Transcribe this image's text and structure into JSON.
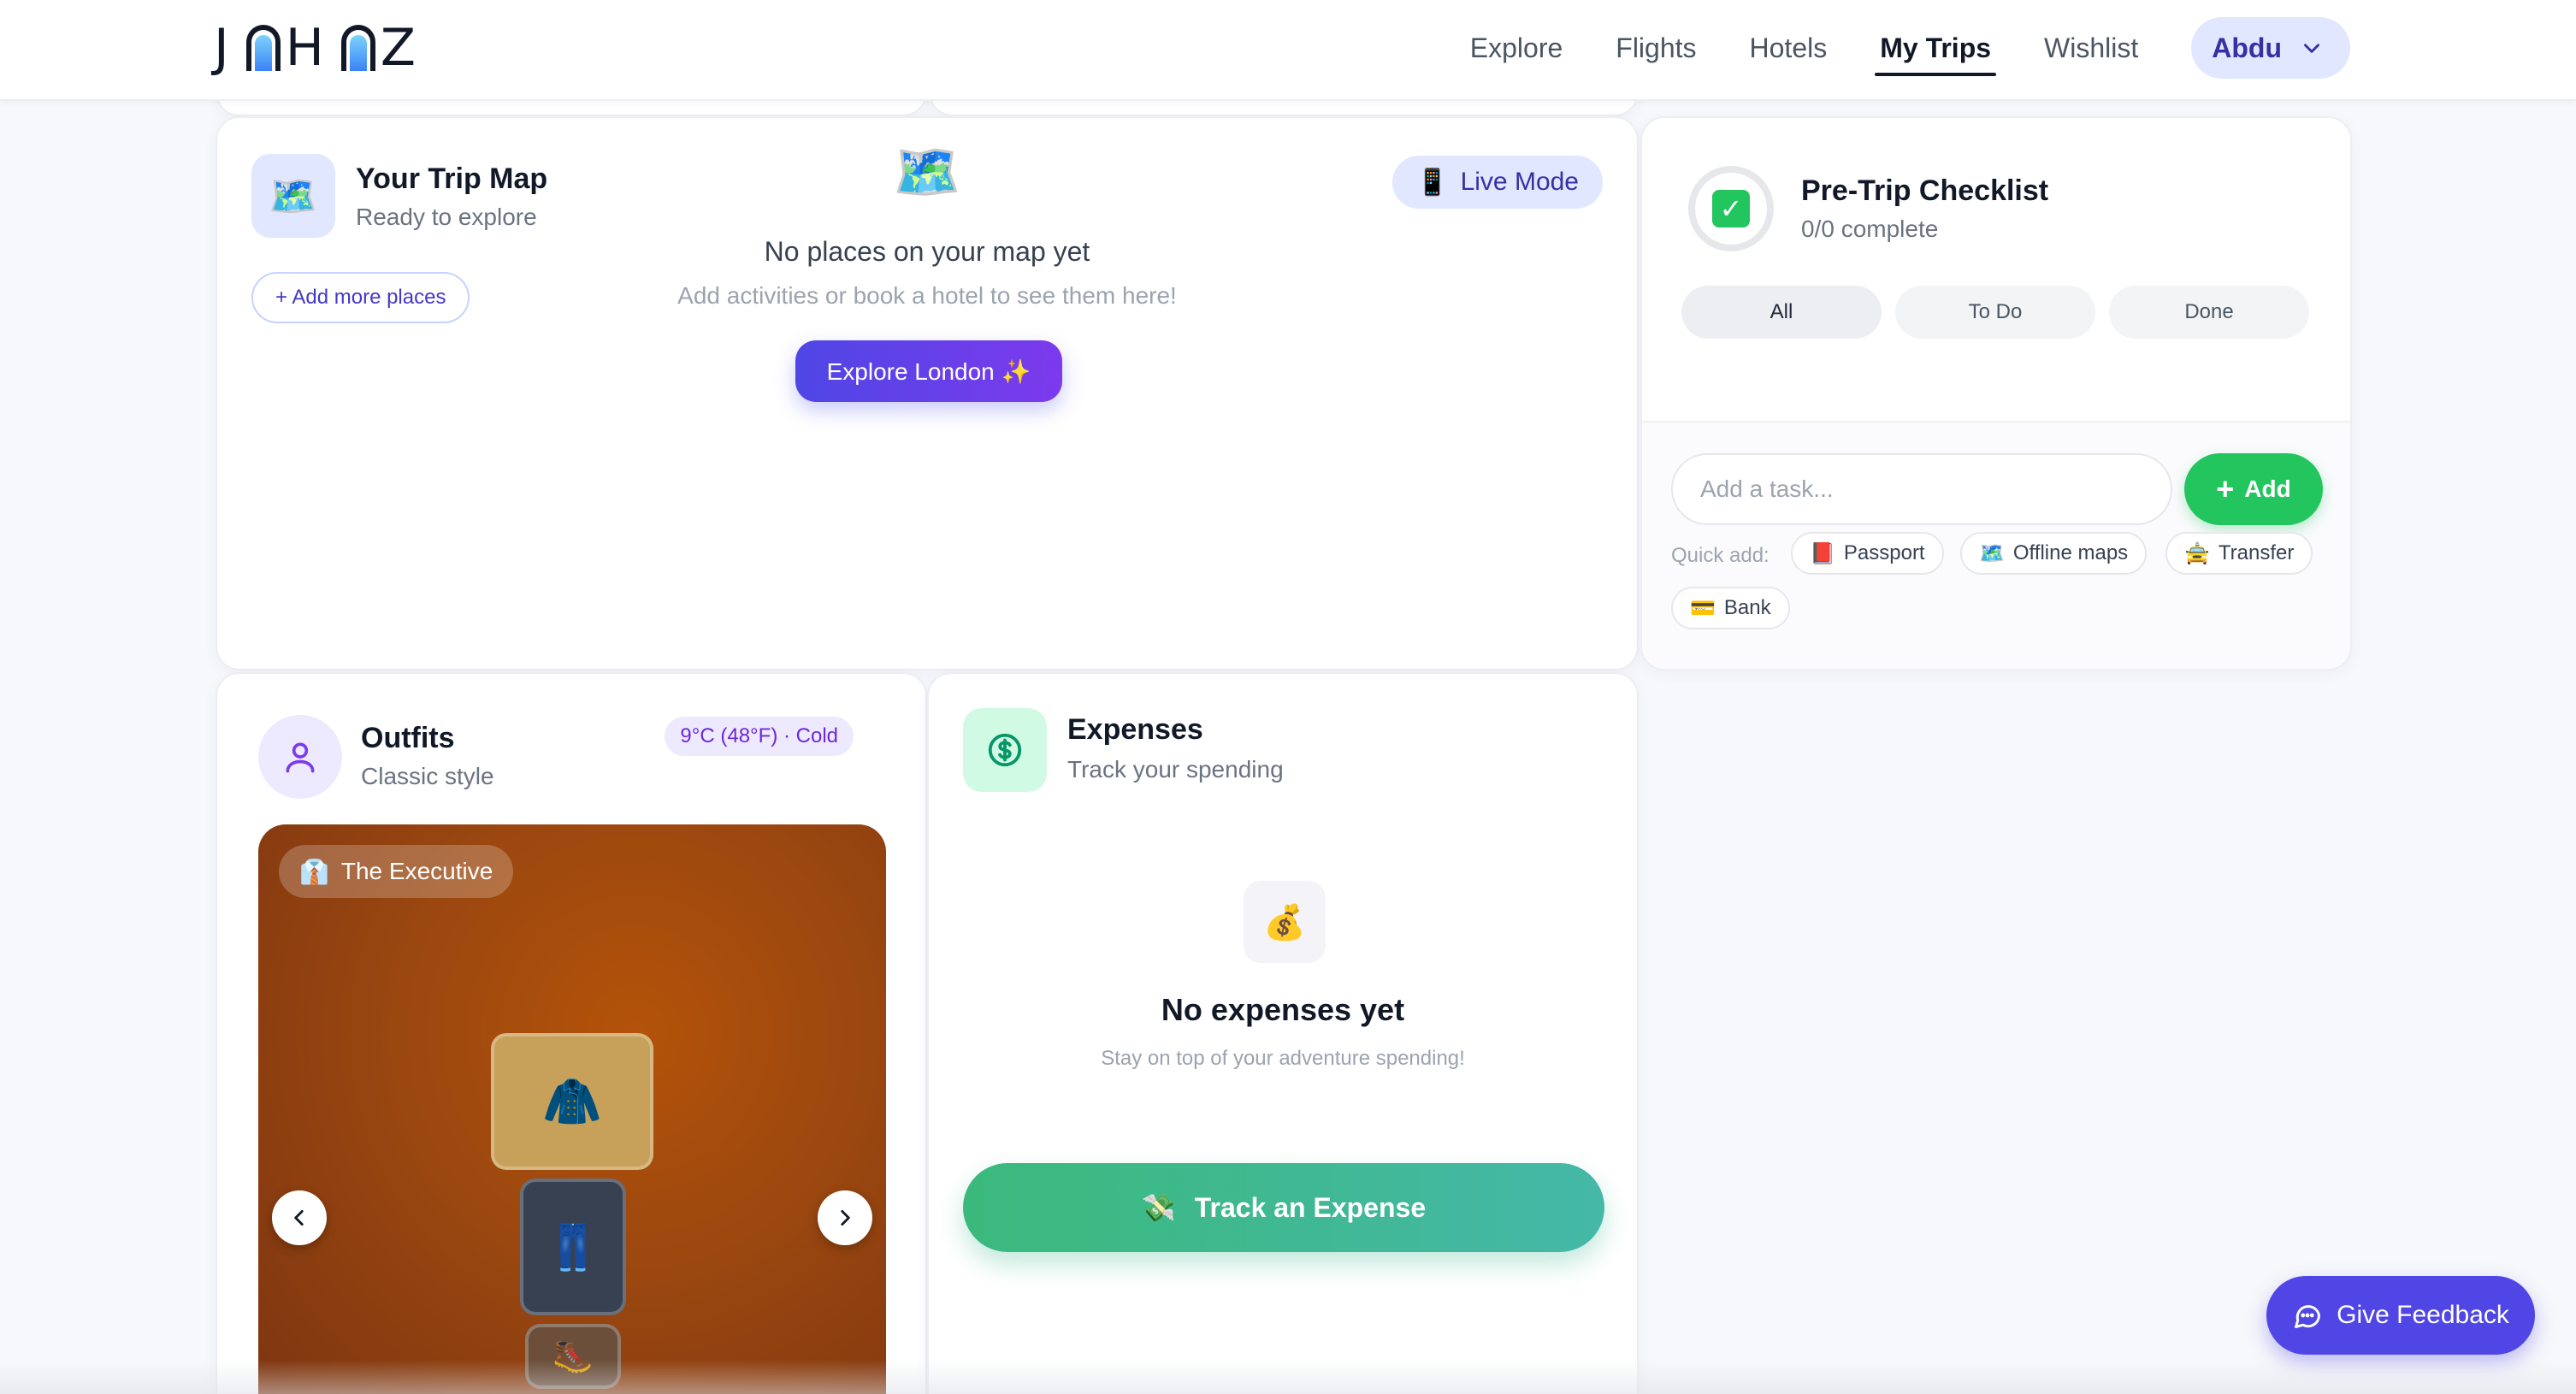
{
  "nav": {
    "logo": "JAHAZ",
    "items": [
      "Explore",
      "Flights",
      "Hotels",
      "My Trips",
      "Wishlist"
    ],
    "active": "My Trips",
    "user": "Abdu"
  },
  "trip_map": {
    "title": "Your Trip Map",
    "subtitle": "Ready to explore",
    "add_places": "+ Add more places",
    "live_mode": "Live Mode",
    "empty_title": "No places on your map yet",
    "empty_text": "Add activities or book a hotel to see them here!",
    "cta": "Explore London ✨"
  },
  "checklist": {
    "title": "Pre-Trip Checklist",
    "progress": "0/0 complete",
    "filters": [
      "All",
      "To Do",
      "Done"
    ],
    "active_filter": "All",
    "input_placeholder": "Add a task...",
    "add_label": "Add",
    "quick_add_label": "Quick add:",
    "quick_add": [
      {
        "icon": "📕",
        "label": "Passport"
      },
      {
        "icon": "🗺️",
        "label": "Offline maps"
      },
      {
        "icon": "🚖",
        "label": "Transfer"
      },
      {
        "icon": "💳",
        "label": "Bank"
      }
    ]
  },
  "outfits": {
    "title": "Outfits",
    "subtitle": "Classic style",
    "weather": "9°C (48°F) · Cold",
    "look_name": "The Executive",
    "look_icon": "👔",
    "items": [
      "🧥",
      "👖",
      "🥾"
    ]
  },
  "expenses": {
    "title": "Expenses",
    "subtitle": "Track your spending",
    "empty_title": "No expenses yet",
    "empty_text": "Stay on top of your adventure spending!",
    "cta": "Track an Expense",
    "cta_icon": "💸",
    "empty_icon": "💰"
  },
  "feedback": {
    "label": "Give Feedback"
  },
  "colors": {
    "accent": "#4f46e5",
    "success": "#22c55e",
    "expense_green": "#3bb97c",
    "outfit_bg": "#9a4710"
  }
}
